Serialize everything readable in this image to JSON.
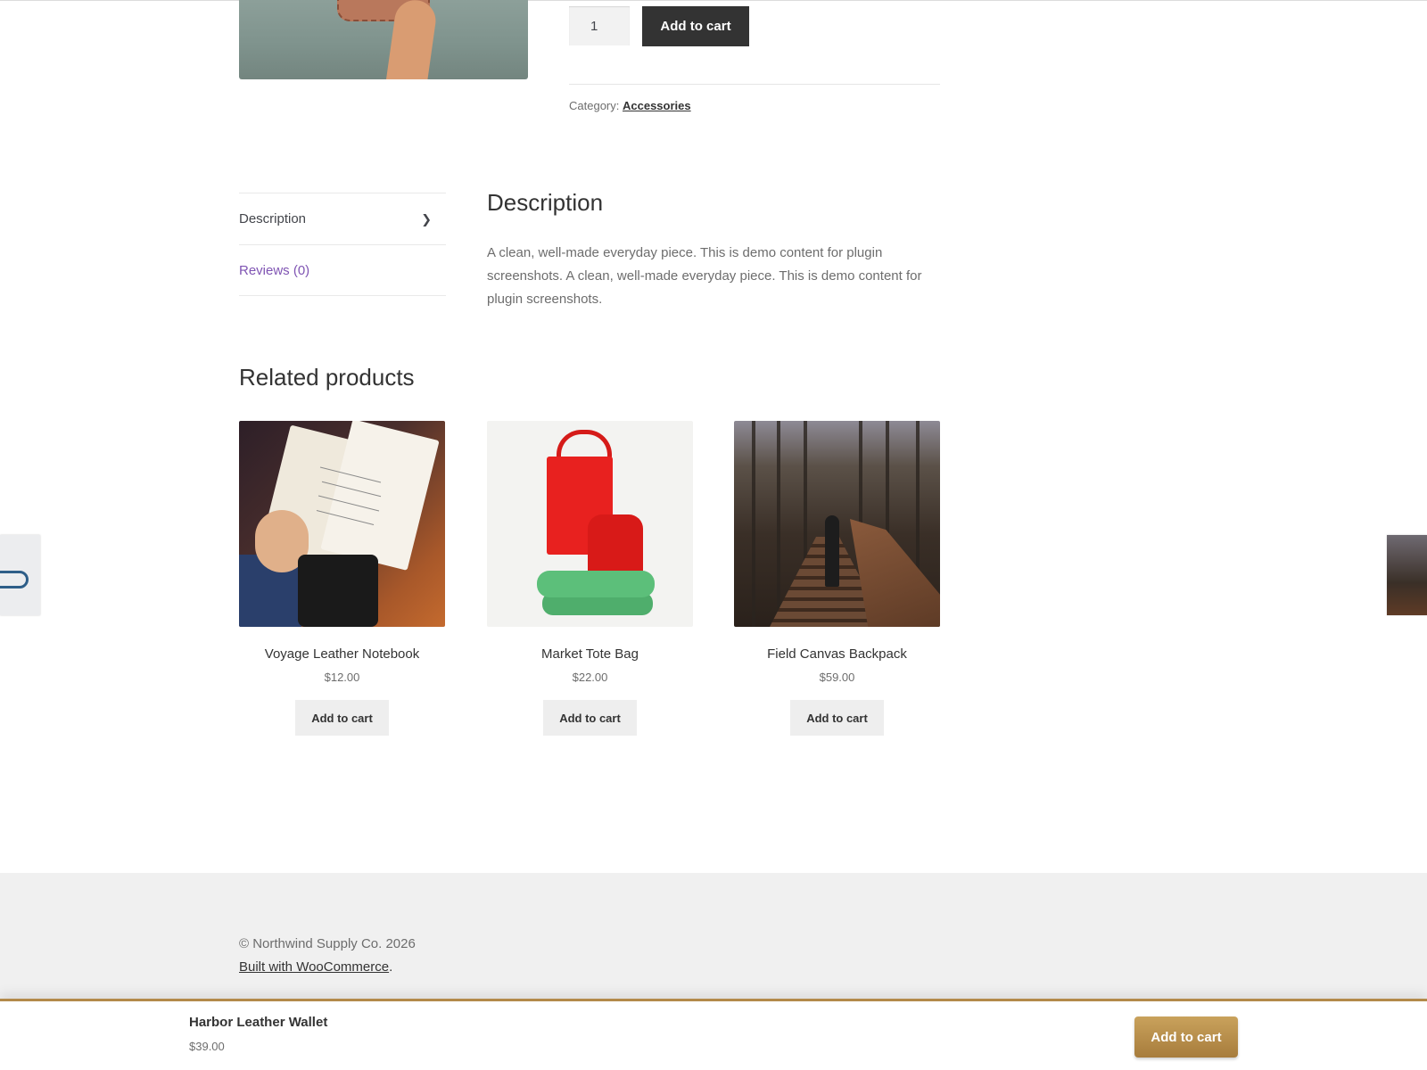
{
  "product": {
    "quantity": "1",
    "add_to_cart_label": "Add to cart",
    "category_label": "Category:",
    "category_value": "Accessories"
  },
  "tabs": [
    {
      "label": "Description",
      "active": true
    },
    {
      "label": "Reviews (0)",
      "active": false
    }
  ],
  "description": {
    "title": "Description",
    "text": "A clean, well-made everyday piece. This is demo content for plugin screenshots. A clean, well-made everyday piece. This is demo content for plugin screenshots."
  },
  "related": {
    "title": "Related products",
    "items": [
      {
        "name": "Voyage Leather Notebook",
        "price": "$12.00",
        "button": "Add to cart"
      },
      {
        "name": "Market Tote Bag",
        "price": "$22.00",
        "button": "Add to cart"
      },
      {
        "name": "Field Canvas Backpack",
        "price": "$59.00",
        "button": "Add to cart"
      }
    ]
  },
  "footer": {
    "copyright": "© Northwind Supply Co. 2026",
    "built_with_link": "Built with WooCommerce",
    "built_with_suffix": "."
  },
  "sticky_bar": {
    "product_name": "Harbor Leather Wallet",
    "price": "$39.00",
    "button": "Add to cart"
  },
  "colors": {
    "tab_link": "#7f54b3",
    "dark_button": "#333333",
    "sticky_button": "#b38a4a"
  }
}
